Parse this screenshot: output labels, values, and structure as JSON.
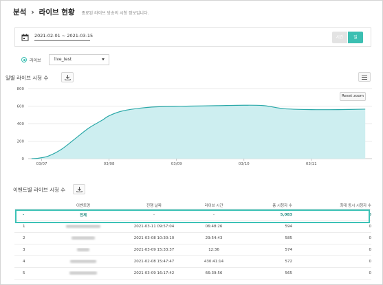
{
  "header": {
    "crumb1": "분석",
    "crumb2": "라이브 현황",
    "description": "종료된 라이브 방송의 시청 정보입니다."
  },
  "date_filter": {
    "range": "2021-02-01 ~ 2021-03-15",
    "seg_hour": "시간",
    "seg_day": "일"
  },
  "filter": {
    "radio_label": "라이브",
    "select_value": "live_test"
  },
  "chart_section": {
    "title": "일별 라이브 시청 수",
    "reset_zoom": "Reset zoom"
  },
  "table_section": {
    "title": "이벤트별 라이브 시청 수"
  },
  "colors": {
    "accent": "#3bbfb2",
    "area_fill": "#cdeef0",
    "line": "#2aa8a8"
  },
  "chart_data": {
    "type": "area",
    "title": "",
    "xlabel": "",
    "ylabel": "",
    "ylim": [
      0,
      800
    ],
    "yticks": [
      "0",
      "200",
      "400",
      "600",
      "800"
    ],
    "xtick_labels": [
      "03/07",
      "03/08",
      "03/09",
      "03/10",
      "03/11"
    ],
    "x": [
      6.85,
      6.95,
      7.1,
      7.3,
      7.5,
      7.7,
      7.9,
      8.0,
      8.2,
      8.5,
      8.8,
      9.2,
      9.6,
      10.0,
      10.3,
      10.6,
      11.0,
      11.4,
      11.8
    ],
    "values": [
      0,
      5,
      30,
      110,
      230,
      350,
      440,
      490,
      545,
      580,
      595,
      600,
      605,
      610,
      605,
      570,
      560,
      560,
      565
    ]
  },
  "table": {
    "columns": [
      "",
      "이벤트명",
      "진행 날짜",
      "라이브 시간",
      "총 시청자 수",
      "최대 동시 시청자 수"
    ],
    "total_row": {
      "no": "-",
      "name": "전체",
      "date": "-",
      "duration": "-",
      "total": "5,083",
      "peak": "0"
    },
    "rows": [
      {
        "no": "1",
        "date": "2021-03-11 09:57:04",
        "duration": "06:48:26",
        "total": "594",
        "peak": "0"
      },
      {
        "no": "2",
        "date": "2021-03-08 10:30:10",
        "duration": "29:54:43",
        "total": "585",
        "peak": "0"
      },
      {
        "no": "3",
        "date": "2021-03-09 15:33:37",
        "duration": "12:36",
        "total": "574",
        "peak": "0"
      },
      {
        "no": "4",
        "date": "2021-02-08 15:47:47",
        "duration": "430:41:14",
        "total": "572",
        "peak": "0"
      },
      {
        "no": "5",
        "date": "2021-03-09 16:17:42",
        "duration": "66:39:56",
        "total": "565",
        "peak": "0"
      }
    ]
  }
}
